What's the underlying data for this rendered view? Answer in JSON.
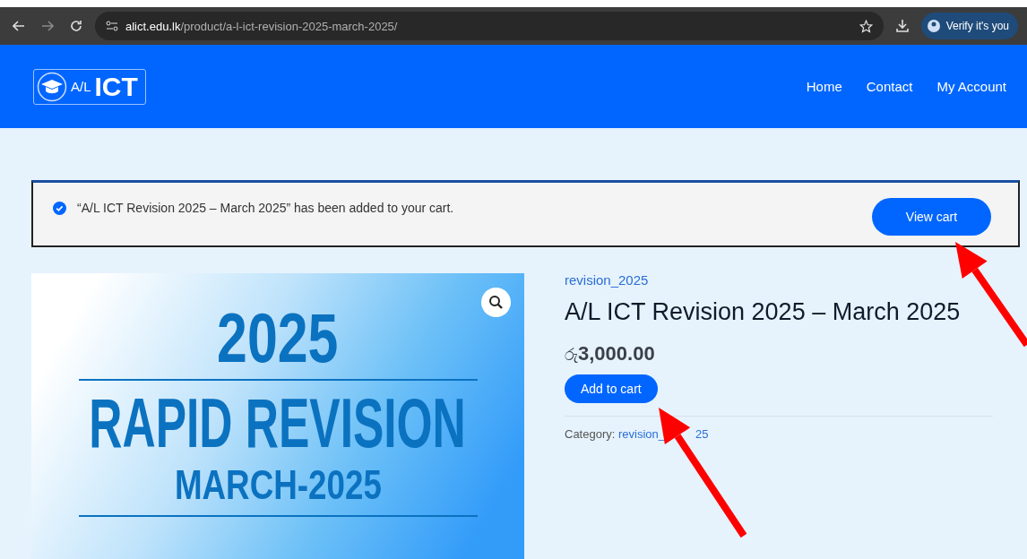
{
  "browser": {
    "url_domain": "alict.edu.lk",
    "url_path": "/product/a-l-ict-revision-2025-march-2025/",
    "profile_button": "Verify it's you"
  },
  "header": {
    "logo_small": "A/L",
    "logo_big": "ICT",
    "nav": [
      {
        "label": "Home"
      },
      {
        "label": "Contact"
      },
      {
        "label": "My Account"
      }
    ]
  },
  "notice": {
    "message": "“A/L ICT Revision 2025 – March 2025” has been added to your cart.",
    "button": "View cart"
  },
  "product": {
    "image_lines": [
      "2025",
      "RAPID REVISION",
      "MARCH-2025"
    ],
    "category_link": "revision_2025",
    "title": "A/L ICT Revision 2025 – March 2025",
    "price_symbol": "රු",
    "price": "3,000.00",
    "add_button": "Add to cart",
    "category_label": "Category:",
    "category_value_parts": [
      "revision_",
      "25"
    ]
  },
  "annotations": [
    {
      "kind": "arrow"
    },
    {
      "kind": "arrow"
    }
  ]
}
